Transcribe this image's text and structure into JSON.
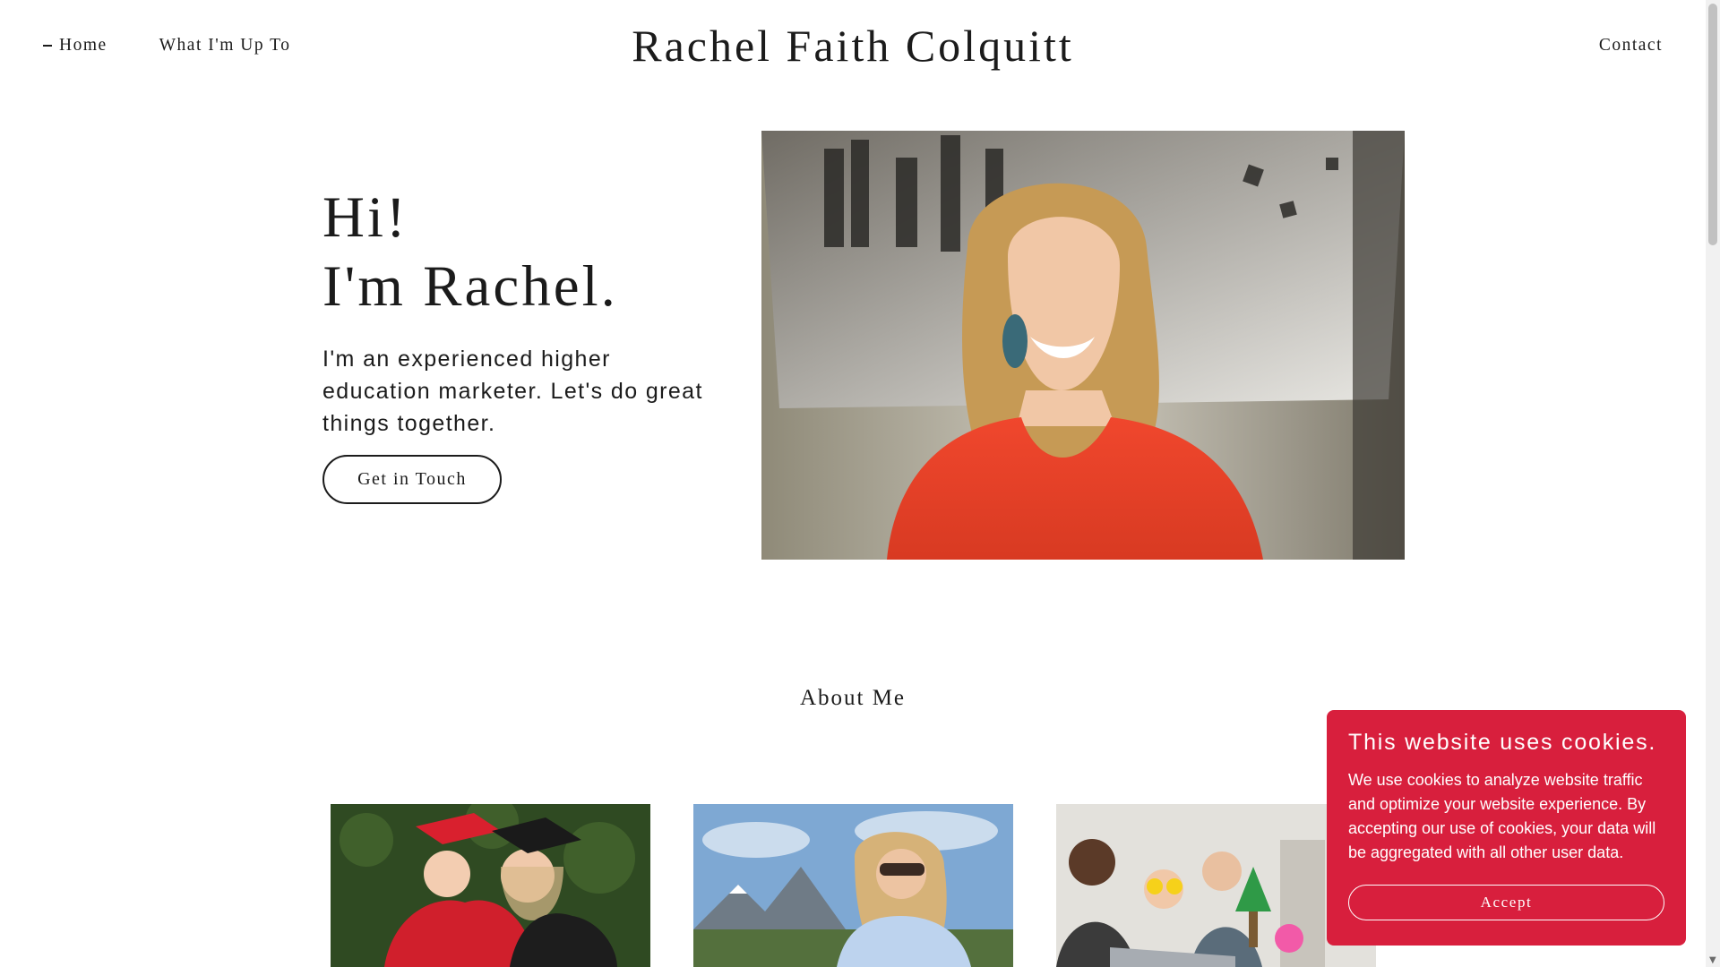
{
  "header": {
    "nav_home": "Home",
    "nav_whats_up": "What I'm Up To",
    "site_title": "Rachel Faith Colquitt",
    "nav_contact": "Contact"
  },
  "hero": {
    "heading_line1": "Hi!",
    "heading_line2": "I'm Rachel.",
    "subtitle": "I'm an experienced higher education marketer. Let's do great things together.",
    "cta_label": "Get in Touch"
  },
  "about": {
    "heading": "About Me"
  },
  "cookie_banner": {
    "title": "This website uses cookies.",
    "text": "We use cookies to analyze website traffic and optimize your website experience. By accepting our use of cookies, your data will be aggregated with all other user data.",
    "accept_label": "Accept"
  },
  "colors": {
    "cookie_bg": "#d81f3d",
    "text": "#1b1b1b"
  }
}
